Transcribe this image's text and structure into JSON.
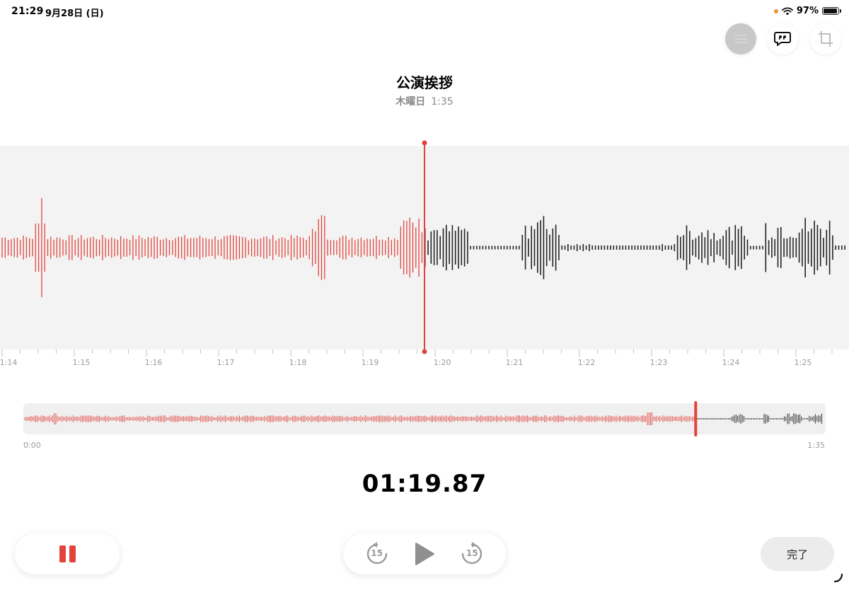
{
  "status": {
    "time": "21:29",
    "date": "9月28日 (日)",
    "battery": "97%",
    "battery_level": 0.97
  },
  "toolbar": {
    "filter_icon": "filter-icon",
    "transcript_icon": "transcript-quote-icon",
    "crop_icon": "crop-icon"
  },
  "recording": {
    "title": "公演挨拶",
    "day": "木曜日",
    "duration": "1:35"
  },
  "timeline": {
    "ticks": [
      "1:14",
      "1:15",
      "1:16",
      "1:17",
      "1:18",
      "1:19",
      "1:20",
      "1:21",
      "1:22",
      "1:23",
      "1:24",
      "1:25"
    ]
  },
  "overview": {
    "start": "0:00",
    "end": "1:35",
    "progress": 0.838
  },
  "playback": {
    "elapsed": "01:19.87"
  },
  "controls": {
    "pause_icon": "pause-icon",
    "skip_back_label": "15",
    "skip_forward_label": "15",
    "play_icon": "play-icon",
    "done_label": "完了"
  },
  "colors": {
    "played": "#e2433b",
    "unplayed": "#222222",
    "background": "#f3f3f3"
  }
}
